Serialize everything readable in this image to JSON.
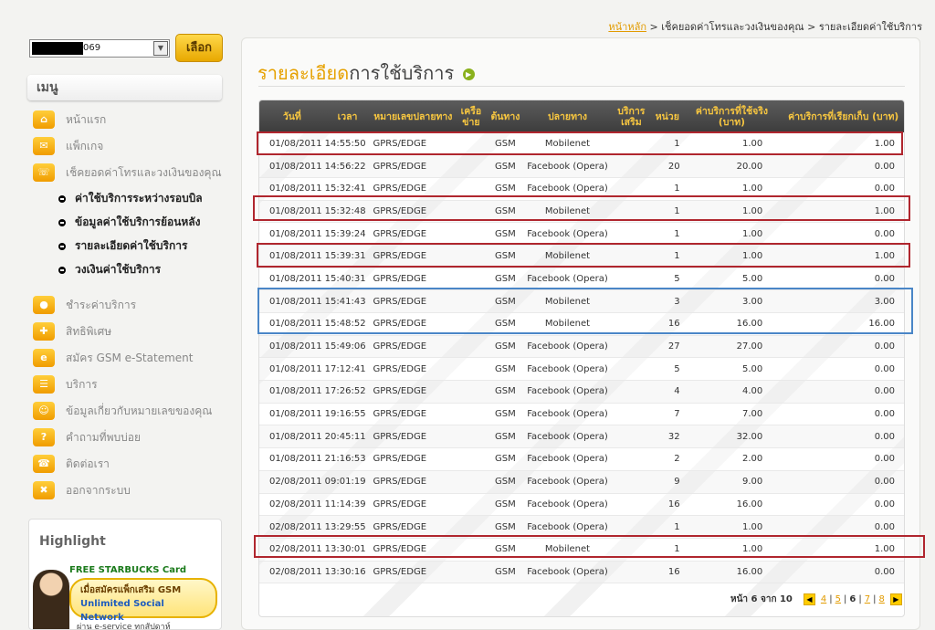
{
  "breadcrumb": {
    "home": "หน้าหลัก",
    "sep1": ">",
    "level1": "เช็คยอดค่าโทรและวงเงินของคุณ",
    "sep2": ">",
    "level2": "รายละเอียดค่าใช้บริการ"
  },
  "phone_select": {
    "value_suffix": "069",
    "button": "เลือก"
  },
  "menu": {
    "title": "เมนู",
    "items": [
      {
        "label": "หน้าแรก",
        "icon": "home-icon",
        "glyph": "⌂"
      },
      {
        "label": "แพ็กเกจ",
        "icon": "package-icon",
        "glyph": "✉"
      },
      {
        "label": "เช็คยอดค่าโทรและวงเงินของคุณ",
        "icon": "phone-icon",
        "glyph": "☏"
      }
    ],
    "submenu": [
      "ค่าใช้บริการระหว่างรอบบิล",
      "ข้อมูลค่าใช้บริการย้อนหลัง",
      "รายละเอียดค่าใช้บริการ",
      "วงเงินค่าใช้บริการ"
    ],
    "items2": [
      {
        "label": "ชำระค่าบริการ",
        "icon": "coin-icon",
        "glyph": "●"
      },
      {
        "label": "สิทธิพิเศษ",
        "icon": "gift-icon",
        "glyph": "✚"
      },
      {
        "label": "สมัคร GSM e-Statement",
        "icon": "statement-icon",
        "glyph": "e"
      },
      {
        "label": "บริการ",
        "icon": "service-icon",
        "glyph": "☰"
      },
      {
        "label": "ข้อมูลเกี่ยวกับหมายเลขของคุณ",
        "icon": "user-icon",
        "glyph": "☺"
      },
      {
        "label": "คำถามที่พบบ่อย",
        "icon": "faq-icon",
        "glyph": "?"
      },
      {
        "label": "ติดต่อเรา",
        "icon": "contact-icon",
        "glyph": "☎"
      },
      {
        "label": "ออกจากระบบ",
        "icon": "lock-icon",
        "glyph": "✖"
      }
    ]
  },
  "highlight": {
    "title": "Highlight",
    "card": "FREE STARBUCKS Card",
    "line1": "เมื่อสมัครแพ็กเสริม GSM",
    "line2": "Unlimited Social Network",
    "footer": "ผ่าน e-service ทุกสัปดาห์"
  },
  "page": {
    "title_accent": "รายละเอียด",
    "title_rest": "การใช้บริการ"
  },
  "table": {
    "headers": [
      "วันที่",
      "เวลา",
      "หมายเลขปลายทาง",
      "เครือข่าย",
      "ต้นทาง",
      "ปลายทาง",
      "บริการเสริม",
      "หน่วย",
      "ค่าบริการที่ใช้จริง (บาท)",
      "ค่าบริการที่เรียกเก็บ (บาท)"
    ],
    "rows": [
      {
        "date": "01/08/2011",
        "time": "14:55:50",
        "dest": "GPRS/EDGE",
        "net": "",
        "src": "GSM",
        "to": "Mobilenet",
        "extra": "",
        "unit": "1",
        "actual": "1.00",
        "charged": "1.00"
      },
      {
        "date": "01/08/2011",
        "time": "14:56:22",
        "dest": "GPRS/EDGE",
        "net": "",
        "src": "GSM",
        "to": "Facebook (Opera)",
        "extra": "",
        "unit": "20",
        "actual": "20.00",
        "charged": "0.00"
      },
      {
        "date": "01/08/2011",
        "time": "15:32:41",
        "dest": "GPRS/EDGE",
        "net": "",
        "src": "GSM",
        "to": "Facebook (Opera)",
        "extra": "",
        "unit": "1",
        "actual": "1.00",
        "charged": "0.00"
      },
      {
        "date": "01/08/2011",
        "time": "15:32:48",
        "dest": "GPRS/EDGE",
        "net": "",
        "src": "GSM",
        "to": "Mobilenet",
        "extra": "",
        "unit": "1",
        "actual": "1.00",
        "charged": "1.00"
      },
      {
        "date": "01/08/2011",
        "time": "15:39:24",
        "dest": "GPRS/EDGE",
        "net": "",
        "src": "GSM",
        "to": "Facebook (Opera)",
        "extra": "",
        "unit": "1",
        "actual": "1.00",
        "charged": "0.00"
      },
      {
        "date": "01/08/2011",
        "time": "15:39:31",
        "dest": "GPRS/EDGE",
        "net": "",
        "src": "GSM",
        "to": "Mobilenet",
        "extra": "",
        "unit": "1",
        "actual": "1.00",
        "charged": "1.00"
      },
      {
        "date": "01/08/2011",
        "time": "15:40:31",
        "dest": "GPRS/EDGE",
        "net": "",
        "src": "GSM",
        "to": "Facebook (Opera)",
        "extra": "",
        "unit": "5",
        "actual": "5.00",
        "charged": "0.00"
      },
      {
        "date": "01/08/2011",
        "time": "15:41:43",
        "dest": "GPRS/EDGE",
        "net": "",
        "src": "GSM",
        "to": "Mobilenet",
        "extra": "",
        "unit": "3",
        "actual": "3.00",
        "charged": "3.00"
      },
      {
        "date": "01/08/2011",
        "time": "15:48:52",
        "dest": "GPRS/EDGE",
        "net": "",
        "src": "GSM",
        "to": "Mobilenet",
        "extra": "",
        "unit": "16",
        "actual": "16.00",
        "charged": "16.00"
      },
      {
        "date": "01/08/2011",
        "time": "15:49:06",
        "dest": "GPRS/EDGE",
        "net": "",
        "src": "GSM",
        "to": "Facebook (Opera)",
        "extra": "",
        "unit": "27",
        "actual": "27.00",
        "charged": "0.00"
      },
      {
        "date": "01/08/2011",
        "time": "17:12:41",
        "dest": "GPRS/EDGE",
        "net": "",
        "src": "GSM",
        "to": "Facebook (Opera)",
        "extra": "",
        "unit": "5",
        "actual": "5.00",
        "charged": "0.00"
      },
      {
        "date": "01/08/2011",
        "time": "17:26:52",
        "dest": "GPRS/EDGE",
        "net": "",
        "src": "GSM",
        "to": "Facebook (Opera)",
        "extra": "",
        "unit": "4",
        "actual": "4.00",
        "charged": "0.00"
      },
      {
        "date": "01/08/2011",
        "time": "19:16:55",
        "dest": "GPRS/EDGE",
        "net": "",
        "src": "GSM",
        "to": "Facebook (Opera)",
        "extra": "",
        "unit": "7",
        "actual": "7.00",
        "charged": "0.00"
      },
      {
        "date": "01/08/2011",
        "time": "20:45:11",
        "dest": "GPRS/EDGE",
        "net": "",
        "src": "GSM",
        "to": "Facebook (Opera)",
        "extra": "",
        "unit": "32",
        "actual": "32.00",
        "charged": "0.00"
      },
      {
        "date": "01/08/2011",
        "time": "21:16:53",
        "dest": "GPRS/EDGE",
        "net": "",
        "src": "GSM",
        "to": "Facebook (Opera)",
        "extra": "",
        "unit": "2",
        "actual": "2.00",
        "charged": "0.00"
      },
      {
        "date": "02/08/2011",
        "time": "09:01:19",
        "dest": "GPRS/EDGE",
        "net": "",
        "src": "GSM",
        "to": "Facebook (Opera)",
        "extra": "",
        "unit": "9",
        "actual": "9.00",
        "charged": "0.00"
      },
      {
        "date": "02/08/2011",
        "time": "11:14:39",
        "dest": "GPRS/EDGE",
        "net": "",
        "src": "GSM",
        "to": "Facebook (Opera)",
        "extra": "",
        "unit": "16",
        "actual": "16.00",
        "charged": "0.00"
      },
      {
        "date": "02/08/2011",
        "time": "13:29:55",
        "dest": "GPRS/EDGE",
        "net": "",
        "src": "GSM",
        "to": "Facebook (Opera)",
        "extra": "",
        "unit": "1",
        "actual": "1.00",
        "charged": "0.00"
      },
      {
        "date": "02/08/2011",
        "time": "13:30:01",
        "dest": "GPRS/EDGE",
        "net": "",
        "src": "GSM",
        "to": "Mobilenet",
        "extra": "",
        "unit": "1",
        "actual": "1.00",
        "charged": "1.00"
      },
      {
        "date": "02/08/2011",
        "time": "13:30:16",
        "dest": "GPRS/EDGE",
        "net": "",
        "src": "GSM",
        "to": "Facebook (Opera)",
        "extra": "",
        "unit": "16",
        "actual": "16.00",
        "charged": "0.00"
      }
    ]
  },
  "pager": {
    "label": "หน้า 6 จาก 10",
    "prev_icon": "prev-arrow-icon",
    "next_icon": "next-arrow-icon",
    "pages": [
      {
        "n": "4",
        "current": false
      },
      {
        "n": "5",
        "current": false
      },
      {
        "n": "6",
        "current": true
      },
      {
        "n": "7",
        "current": false
      },
      {
        "n": "8",
        "current": false
      }
    ]
  },
  "annotation_colors": {
    "red": "#b0262e",
    "blue": "#4a86c7"
  }
}
